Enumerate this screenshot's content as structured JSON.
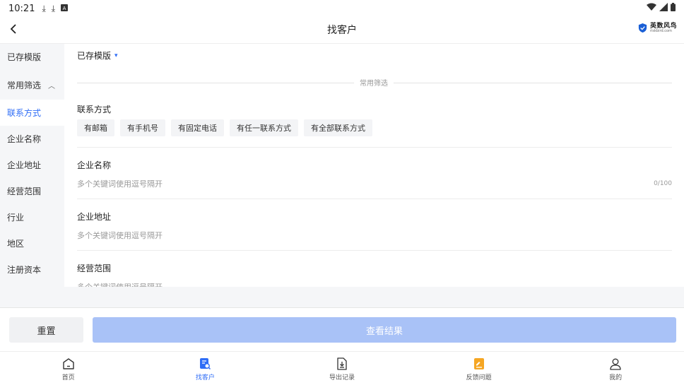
{
  "status_bar": {
    "time": "10:21"
  },
  "header": {
    "title": "找客户",
    "brand_name": "英数风鸟",
    "brand_url": "riskbird.com"
  },
  "sidebar": {
    "items": [
      {
        "label": "已存模版"
      },
      {
        "label": "常用筛选",
        "expanded": true
      },
      {
        "label": "联系方式",
        "active": true
      },
      {
        "label": "企业名称"
      },
      {
        "label": "企业地址"
      },
      {
        "label": "经营范围"
      },
      {
        "label": "行业"
      },
      {
        "label": "地区"
      },
      {
        "label": "注册资本"
      }
    ]
  },
  "main": {
    "template_label": "已存模版",
    "divider_label": "常用筛选",
    "contact": {
      "title": "联系方式",
      "chips": [
        "有邮箱",
        "有手机号",
        "有固定电话",
        "有任一联系方式",
        "有全部联系方式"
      ]
    },
    "company_name": {
      "title": "企业名称",
      "placeholder": "多个关键词使用逗号隔开",
      "count": "0/100"
    },
    "company_address": {
      "title": "企业地址",
      "placeholder": "多个关键词使用逗号隔开"
    },
    "business_scope": {
      "title": "经营范围",
      "placeholder": "多个关键词使用逗号隔开"
    }
  },
  "actions": {
    "reset": "重置",
    "view_results": "查看结果"
  },
  "bottom_nav": {
    "items": [
      {
        "label": "首页",
        "icon": "home-icon"
      },
      {
        "label": "找客户",
        "icon": "find-customer-icon",
        "active": true
      },
      {
        "label": "导出记录",
        "icon": "export-record-icon"
      },
      {
        "label": "反馈问题",
        "icon": "feedback-icon"
      },
      {
        "label": "我的",
        "icon": "profile-icon"
      }
    ]
  },
  "colors": {
    "accent": "#2f6df6",
    "button_disabled": "#a9c2f7",
    "feedback_orange": "#f5a623"
  }
}
